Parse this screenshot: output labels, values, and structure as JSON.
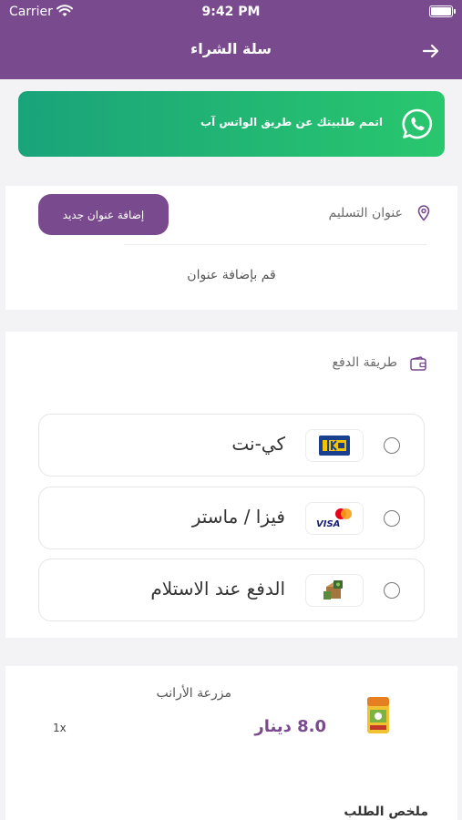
{
  "status_bar": {
    "carrier": "Carrier",
    "time": "9:42 PM"
  },
  "nav": {
    "title": "سلة الشراء"
  },
  "whatsapp": {
    "text": "اتمم طلبيتك عن طريق الواتس آب"
  },
  "address": {
    "label": "عنوان التسليم",
    "add_button": "إضافة عنوان جديد",
    "empty_text": "قم بإضافة عنوان"
  },
  "payment": {
    "label": "طريقة الدفع",
    "options": [
      {
        "label": "كي-نت",
        "logo": "knet-logo"
      },
      {
        "label": "فيزا / ماستر",
        "logo": "visa-mastercard-logo"
      },
      {
        "label": "الدفع عند الاستلام",
        "logo": "cash-on-delivery-logo"
      }
    ]
  },
  "cart": {
    "items": [
      {
        "name": "مزرعة الأرانب",
        "price": "8.0 دينار",
        "qty": "1x"
      }
    ],
    "summary_label": "ملخص الطلب"
  },
  "colors": {
    "primary": "#7a4a8f",
    "whatsapp_start": "#1aa37a",
    "whatsapp_end": "#29c76e",
    "background": "#f3f3f5"
  }
}
